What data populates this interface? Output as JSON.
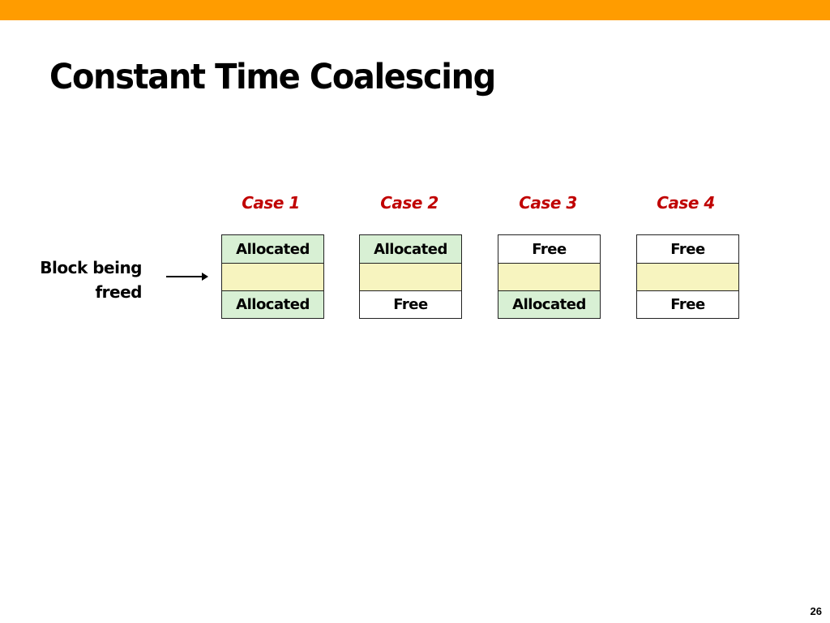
{
  "slide": {
    "title": "Constant Time Coalescing",
    "page_number": "26",
    "accent_color": "#FF9C00",
    "case_label_color": "#C00000"
  },
  "side_label": {
    "line1": "Block being",
    "line2": "freed"
  },
  "colors": {
    "allocated": "#D8F0D4",
    "being_freed": "#F7F4BF",
    "free": "#FFFFFF"
  },
  "cases": [
    {
      "label": "Case 1",
      "top": {
        "text": "Allocated",
        "state": "allocated"
      },
      "middle": {
        "text": "",
        "state": "being_freed"
      },
      "bottom": {
        "text": "Allocated",
        "state": "allocated"
      }
    },
    {
      "label": "Case 2",
      "top": {
        "text": "Allocated",
        "state": "allocated"
      },
      "middle": {
        "text": "",
        "state": "being_freed"
      },
      "bottom": {
        "text": "Free",
        "state": "free"
      }
    },
    {
      "label": "Case 3",
      "top": {
        "text": "Free",
        "state": "free"
      },
      "middle": {
        "text": "",
        "state": "being_freed"
      },
      "bottom": {
        "text": "Allocated",
        "state": "allocated"
      }
    },
    {
      "label": "Case 4",
      "top": {
        "text": "Free",
        "state": "free"
      },
      "middle": {
        "text": "",
        "state": "being_freed"
      },
      "bottom": {
        "text": "Free",
        "state": "free"
      }
    }
  ]
}
